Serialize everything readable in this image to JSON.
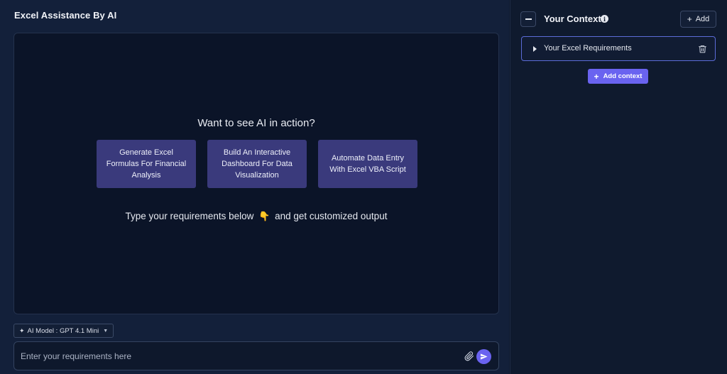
{
  "header": {
    "title": "Excel Assistance By AI"
  },
  "hero": {
    "title": "Want to see AI in action?",
    "subtitle_before": "Type your requirements below",
    "subtitle_icon": "👇",
    "subtitle_after": "and get customized output"
  },
  "prompt_cards": [
    {
      "label": "Generate Excel Formulas For Financial Analysis"
    },
    {
      "label": "Build An Interactive Dashboard For Data Visualization"
    },
    {
      "label": "Automate Data Entry With Excel VBA Script"
    }
  ],
  "model_selector": {
    "label": "AI Model : GPT 4.1 Mini",
    "icon": "sparkle-icon"
  },
  "input": {
    "placeholder": "Enter your requirements here",
    "value": ""
  },
  "context_panel": {
    "title": "Your Context",
    "add_label": "Add",
    "items": [
      {
        "label": "Your Excel Requirements"
      }
    ],
    "add_context_label": "Add context"
  },
  "colors": {
    "background": "#0f1a2e",
    "panel": "#13203a",
    "chat_bg": "#0b1428",
    "card": "#3a3a7c",
    "accent": "#6a63f0",
    "selected_border": "#5b6cd8"
  }
}
